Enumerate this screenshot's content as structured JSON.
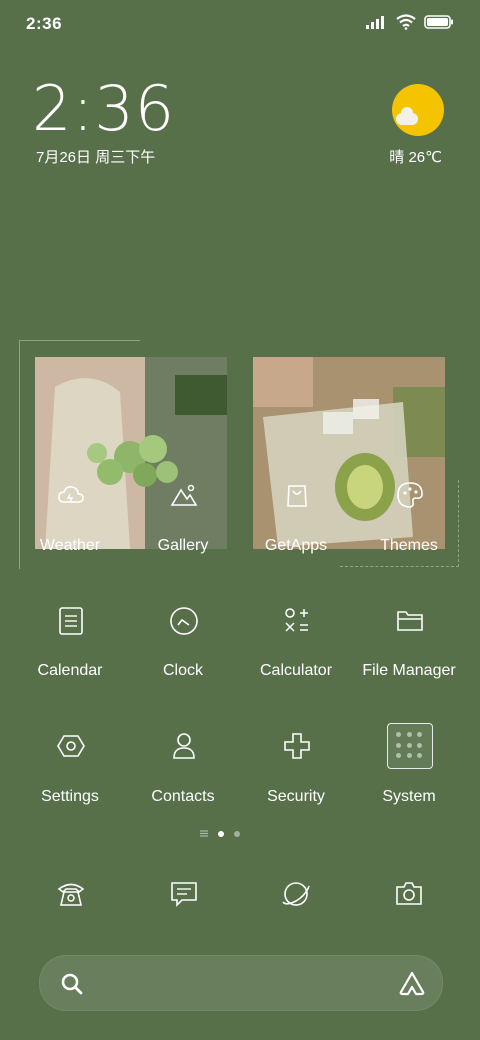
{
  "status": {
    "time": "2:36"
  },
  "clock": {
    "time": "2:36",
    "date": "7月26日 周三下午"
  },
  "weather": {
    "text": "晴 26℃"
  },
  "row1": [
    "Weather",
    "Gallery",
    "GetApps",
    "Themes"
  ],
  "row2": [
    "Calendar",
    "Clock",
    "Calculator",
    "File Manager"
  ],
  "row3": [
    "Settings",
    "Contacts",
    "Security",
    "System"
  ],
  "dock": {
    "icons": [
      "phone-icon",
      "messages-icon",
      "browser-icon",
      "camera-icon"
    ]
  },
  "colors": {
    "background": "#57704a",
    "sun": "#f5c400"
  }
}
